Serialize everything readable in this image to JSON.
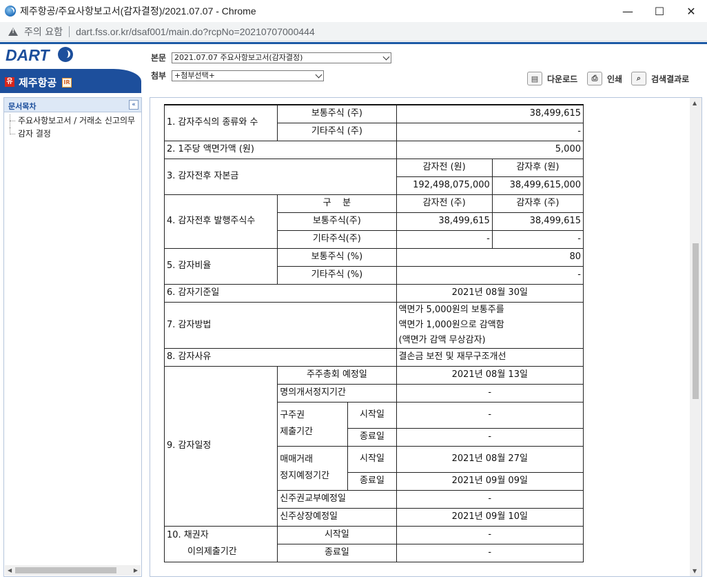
{
  "window": {
    "title": "제주항공/주요사항보고서(감자결정)/2021.07.07 - Chrome",
    "minimize": "—",
    "maximize": "☐",
    "close": "✕"
  },
  "address": {
    "security_label": "주의 요함",
    "url": "dart.fss.or.kr/dsaf001/main.do?rcpNo=20210707000444"
  },
  "header": {
    "logo_text": "DART",
    "company_badge": "유",
    "company_name": "제주항공",
    "ir_badge": "IR",
    "main_label": "본문",
    "main_select": "2021.07.07  주요사항보고서(감자결정)",
    "attach_label": "첨부",
    "attach_select": "+첨부선택+",
    "download_label": "다운로드",
    "print_label": "인쇄",
    "search_label": "검색결과로"
  },
  "sidebar": {
    "title": "문서목차",
    "collapse": "«",
    "items": [
      "주요사항보고서 / 거래소 신고의무",
      "감자 결정"
    ]
  },
  "report": {
    "r1_label": "1. 감자주식의 종류와 수",
    "r1_common": "보통주식 (주)",
    "r1_common_val": "38,499,615",
    "r1_other": "기타주식 (주)",
    "r1_other_val": "-",
    "r2_label": "2. 1주당 액면가액 (원)",
    "r2_val": "5,000",
    "r3_label": "3. 감자전후 자본금",
    "r3_before_h": "감자전 (원)",
    "r3_after_h": "감자후 (원)",
    "r3_before": "192,498,075,000",
    "r3_after": "38,499,615,000",
    "r4_label": "4. 감자전후 발행주식수",
    "r4_div": "구    분",
    "r4_before_h": "감자전 (주)",
    "r4_after_h": "감자후 (주)",
    "r4_common": "보통주식(주)",
    "r4_common_before": "38,499,615",
    "r4_common_after": "38,499,615",
    "r4_other": "기타주식(주)",
    "r4_other_before": "-",
    "r4_other_after": "-",
    "r5_label": "5. 감자비율",
    "r5_common": "보통주식 (%)",
    "r5_common_val": "80",
    "r5_other": "기타주식 (%)",
    "r5_other_val": "-",
    "r6_label": "6. 감자기준일",
    "r6_val": "2021년 08월 30일",
    "r7_label": "7. 감자방법",
    "r7_line1": "액면가 5,000원의 보통주를",
    "r7_line2": "액면가 1,000원으로 감액함",
    "r7_line3": "(액면가 감액 무상감자)",
    "r8_label": "8. 감자사유",
    "r8_val": "결손금 보전 및 재무구조개선",
    "r9_label": "9. 감자일정",
    "r9_meeting": "주주총회 예정일",
    "r9_meeting_val": "2021년 08월 13일",
    "r9_suspend": "명의개서정지기간",
    "r9_suspend_val": "-",
    "r9_old_cert_1": "구주권",
    "r9_old_cert_2": "제출기간",
    "r9_start": "시작일",
    "r9_end": "종료일",
    "r9_old_start_val": "-",
    "r9_old_end_val": "-",
    "r9_trade_1": "매매거래",
    "r9_trade_2": "정지예정기간",
    "r9_trade_start_val": "2021년 08월 27일",
    "r9_trade_end_val": "2021년 09월 09일",
    "r9_new_cert": "신주권교부예정일",
    "r9_new_cert_val": "-",
    "r9_listing": "신주상장예정일",
    "r9_listing_val": "2021년 09월 10일",
    "r10_label_1": "10. 채권자",
    "r10_label_2": "이의제출기간",
    "r10_start": "시작일",
    "r10_start_val": "-",
    "r10_end": "종료일",
    "r10_end_val": "-"
  }
}
